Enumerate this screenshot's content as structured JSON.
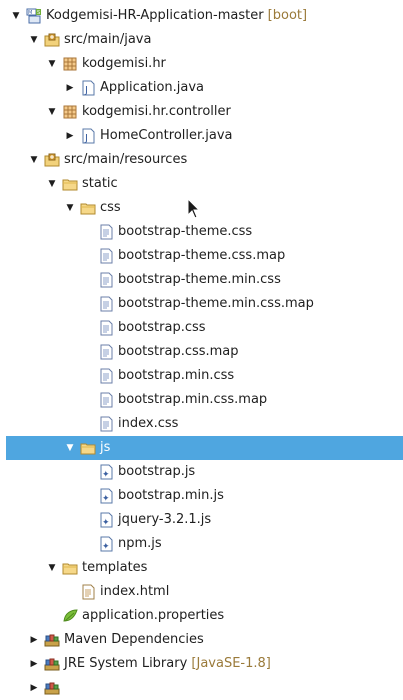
{
  "tree": [
    {
      "label": "Kodgemisi-HR-Application-master",
      "decor": "[boot]",
      "icon": "boot-project",
      "level": 0,
      "twisty": "expanded"
    },
    {
      "label": "src/main/java",
      "icon": "source-folder",
      "level": 1,
      "twisty": "expanded"
    },
    {
      "label": "kodgemisi.hr",
      "icon": "package",
      "level": 2,
      "twisty": "expanded"
    },
    {
      "label": "Application.java",
      "icon": "java-file",
      "level": 3,
      "twisty": "collapsed"
    },
    {
      "label": "kodgemisi.hr.controller",
      "icon": "package",
      "level": 2,
      "twisty": "expanded"
    },
    {
      "label": "HomeController.java",
      "icon": "java-file",
      "level": 3,
      "twisty": "collapsed"
    },
    {
      "label": "src/main/resources",
      "icon": "source-folder",
      "level": 1,
      "twisty": "expanded"
    },
    {
      "label": "static",
      "icon": "folder",
      "level": 2,
      "twisty": "expanded"
    },
    {
      "label": "css",
      "icon": "folder",
      "level": 3,
      "twisty": "expanded"
    },
    {
      "label": "bootstrap-theme.css",
      "icon": "text-file",
      "level": 4
    },
    {
      "label": "bootstrap-theme.css.map",
      "icon": "text-file",
      "level": 4
    },
    {
      "label": "bootstrap-theme.min.css",
      "icon": "text-file",
      "level": 4
    },
    {
      "label": "bootstrap-theme.min.css.map",
      "icon": "text-file",
      "level": 4
    },
    {
      "label": "bootstrap.css",
      "icon": "text-file",
      "level": 4
    },
    {
      "label": "bootstrap.css.map",
      "icon": "text-file",
      "level": 4
    },
    {
      "label": "bootstrap.min.css",
      "icon": "text-file",
      "level": 4
    },
    {
      "label": "bootstrap.min.css.map",
      "icon": "text-file",
      "level": 4
    },
    {
      "label": "index.css",
      "icon": "text-file",
      "level": 4
    },
    {
      "label": "js",
      "icon": "folder",
      "level": 3,
      "twisty": "expanded",
      "selected": true
    },
    {
      "label": "bootstrap.js",
      "icon": "js-file",
      "level": 4
    },
    {
      "label": "bootstrap.min.js",
      "icon": "js-file",
      "level": 4
    },
    {
      "label": "jquery-3.2.1.js",
      "icon": "js-file",
      "level": 4
    },
    {
      "label": "npm.js",
      "icon": "js-file",
      "level": 4
    },
    {
      "label": "templates",
      "icon": "folder",
      "level": 2,
      "twisty": "expanded"
    },
    {
      "label": "index.html",
      "icon": "html-file",
      "level": 3
    },
    {
      "label": "application.properties",
      "icon": "properties-file",
      "level": 2
    },
    {
      "label": "Maven Dependencies",
      "icon": "library",
      "level": 1,
      "twisty": "collapsed"
    },
    {
      "label": "JRE System Library",
      "decor": "[JavaSE-1.8]",
      "icon": "library",
      "level": 1,
      "twisty": "collapsed"
    },
    {
      "label": "",
      "icon": "library",
      "level": 1,
      "twisty": "collapsed",
      "partial": true
    }
  ],
  "colors": {
    "selection": "#4fa6e0",
    "decoration": "#9a7a3a"
  }
}
